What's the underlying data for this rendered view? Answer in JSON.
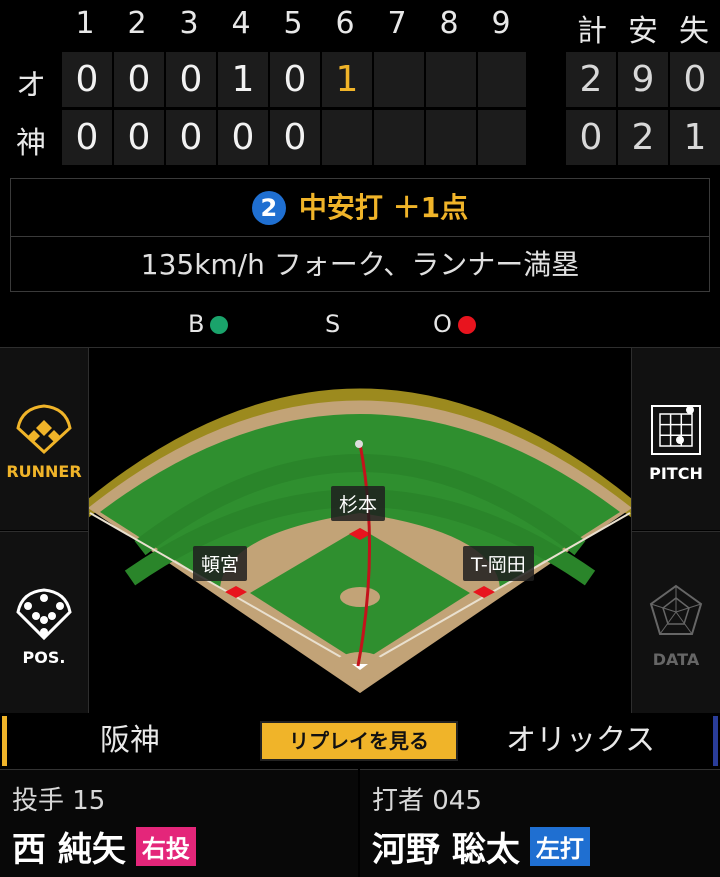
{
  "scoreboard": {
    "innings": [
      "1",
      "2",
      "3",
      "4",
      "5",
      "6",
      "7",
      "8",
      "9"
    ],
    "totals_headers": [
      "計",
      "安",
      "失"
    ],
    "teams": [
      {
        "abbr": "オ",
        "innings": [
          "0",
          "0",
          "0",
          "1",
          "0",
          "1",
          "",
          "",
          ""
        ],
        "totals": [
          "2",
          "9",
          "0"
        ]
      },
      {
        "abbr": "神",
        "innings": [
          "0",
          "0",
          "0",
          "0",
          "0",
          "",
          "",
          "",
          ""
        ],
        "totals": [
          "0",
          "2",
          "1"
        ]
      }
    ]
  },
  "play": {
    "number": "2",
    "result": "中安打 ＋1点",
    "detail": "135km/h フォーク、ランナー満塁"
  },
  "count": {
    "ball": "B",
    "strike": "S",
    "out": "O"
  },
  "side_buttons": {
    "runner": "RUNNER",
    "pitch": "PITCH",
    "pos": "POS.",
    "data": "DATA"
  },
  "fielders": {
    "center": "杉本",
    "left": "頓宮",
    "right": "T-岡田"
  },
  "team_bar": {
    "home": "阪神",
    "replay": "リプレイを見る",
    "away": "オリックス"
  },
  "pitcher": {
    "role": "投手 15",
    "name": "西 純矢",
    "badge": "右投"
  },
  "batter": {
    "role": "打者 045",
    "name": "河野 聡太",
    "badge": "左打"
  },
  "colors": {
    "accent": "#f0b429",
    "ball_dot": "#1aa36b",
    "out_dot": "#e8141e",
    "pitch_badge": "#e4267a",
    "bat_badge": "#1f6fd1"
  }
}
